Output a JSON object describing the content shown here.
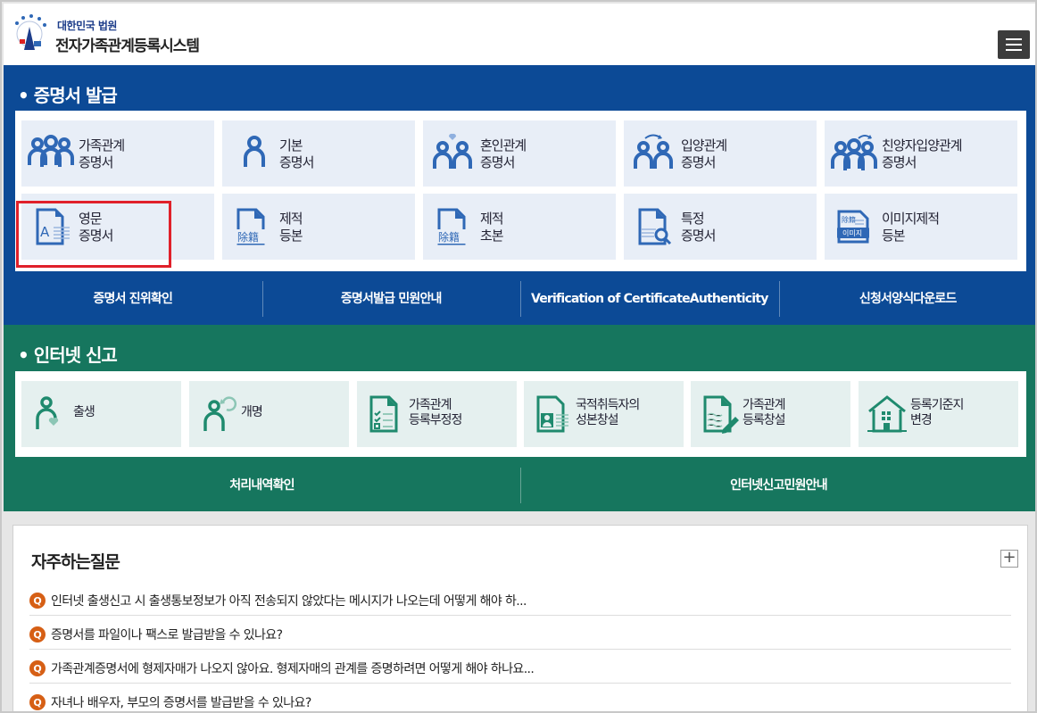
{
  "header": {
    "brand_sub": "대한민국 법원",
    "brand_main": "전자가족관계등록시스템"
  },
  "certificates": {
    "title": "증명서 발급",
    "tiles": [
      {
        "line1": "가족관계",
        "line2": "증명서",
        "icon": "family-icon"
      },
      {
        "line1": "기본",
        "line2": "증명서",
        "icon": "person-icon"
      },
      {
        "line1": "혼인관계",
        "line2": "증명서",
        "icon": "marriage-icon"
      },
      {
        "line1": "입양관계",
        "line2": "증명서",
        "icon": "adoption-icon"
      },
      {
        "line1": "친양자입양관계",
        "line2": "증명서",
        "icon": "full-adoption-icon"
      },
      {
        "line1": "영문",
        "line2": "증명서",
        "icon": "english-document-icon"
      },
      {
        "line1": "제적",
        "line2": "등본",
        "icon": "removed-register-icon"
      },
      {
        "line1": "제적",
        "line2": "초본",
        "icon": "removed-extract-icon"
      },
      {
        "line1": "특정",
        "line2": "증명서",
        "icon": "search-document-icon"
      },
      {
        "line1": "이미지제적",
        "line2": "등본",
        "icon": "image-register-icon"
      }
    ],
    "icon_badges": {
      "removed": "除籍",
      "image": "이미지",
      "english": "A"
    },
    "bar_links": [
      "증명서 진위확인",
      "증명서발급 민원안내",
      "Verification of CertificateAuthenticity",
      "신청서양식다운로드"
    ]
  },
  "internet_report": {
    "title": "인터넷 신고",
    "tiles": [
      {
        "line1": "출생",
        "line2": "",
        "icon": "birth-icon"
      },
      {
        "line1": "개명",
        "line2": "",
        "icon": "rename-icon"
      },
      {
        "line1": "가족관계",
        "line2": "등록부정정",
        "icon": "checklist-icon"
      },
      {
        "line1": "국적취득자의",
        "line2": "성본창설",
        "icon": "id-card-icon"
      },
      {
        "line1": "가족관계",
        "line2": "등록창설",
        "icon": "pen-document-icon"
      },
      {
        "line1": "등록기준지",
        "line2": "변경",
        "icon": "house-icon"
      }
    ],
    "bar_links": [
      "처리내역확인",
      "인터넷신고민원안내"
    ]
  },
  "faq": {
    "title": "자주하는질문",
    "plus": "+",
    "badge": "Q",
    "items": [
      "인터넷 출생신고 시 출생통보정보가 아직 전송되지 않았다는 메시지가 나오는데 어떻게 해야 하...",
      "증명서를 파일이나 팩스로 발급받을 수 있나요?",
      "가족관계증명서에 형제자매가 나오지 않아요. 형제자매의 관계를 증명하려면 어떻게 해야 하나요...",
      "자녀나 배우자, 부모의 증명서를 발급받을 수 있나요?"
    ]
  },
  "colors": {
    "blue_section": "#0c4a96",
    "green_section": "#16765e",
    "blue_icon": "#2f68b6",
    "green_icon": "#1f8a6e",
    "highlight": "#e0202a",
    "faq_badge": "#d65f15"
  }
}
